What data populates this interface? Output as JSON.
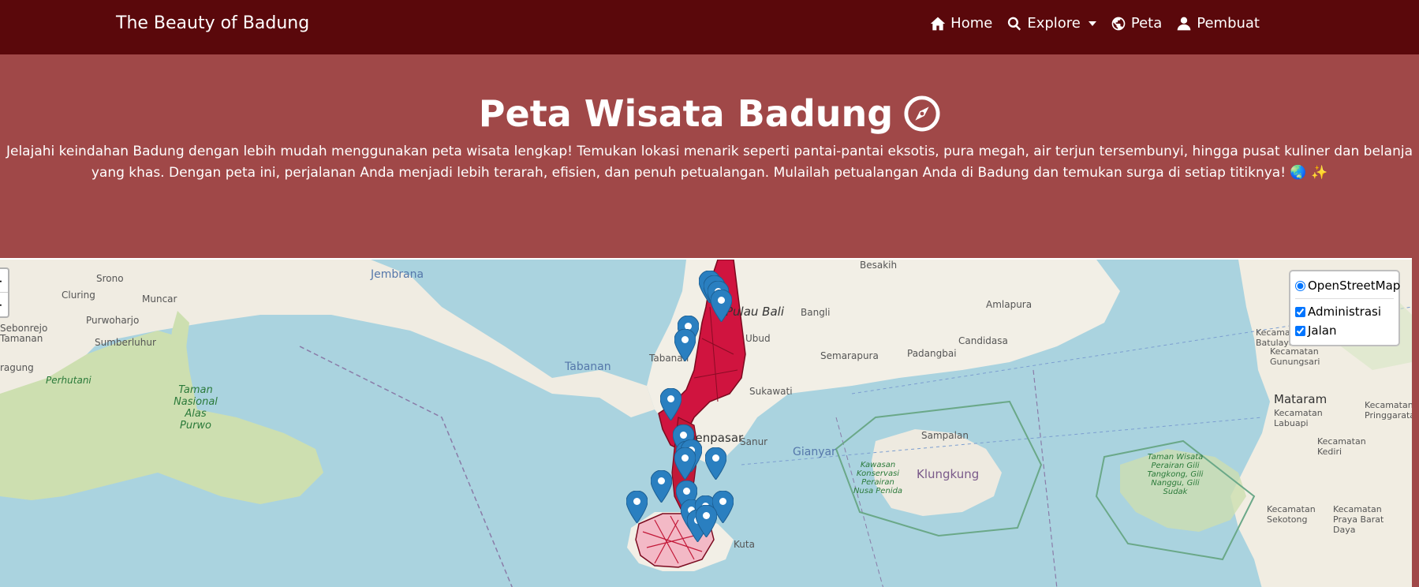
{
  "navbar": {
    "brand": "The Beauty of Badung",
    "items": [
      {
        "label": "Home",
        "icon": "home-icon"
      },
      {
        "label": "Explore",
        "icon": "search-icon"
      },
      {
        "label": "Peta",
        "icon": "globe-icon"
      },
      {
        "label": "Pembuat",
        "icon": "user-icon"
      }
    ]
  },
  "hero": {
    "title": "Peta Wisata Badung",
    "description": "Jelajahi keindahan Badung dengan lebih mudah menggunakan peta wisata lengkap! Temukan lokasi menarik seperti pantai-pantai eksotis, pura megah, air terjun tersembunyi, hingga pusat kuliner dan belanja yang khas. Dengan peta ini, perjalanan Anda menjadi lebih terarah, efisien, dan penuh petualangan. Mulailah petualangan Anda di Badung dan temukan surga di setiap titiknya! 🌏 ✨"
  },
  "map": {
    "zoom_in": "+",
    "zoom_out": "−",
    "base_layer": "OpenStreetMap",
    "overlays": [
      {
        "label": "Administrasi",
        "checked": true
      },
      {
        "label": "Jalan",
        "checked": true
      }
    ],
    "labels": {
      "jembrana": "Jembrana",
      "srono": "Srono",
      "cluring": "Cluring",
      "muncar": "Muncar",
      "purwoharjo": "Purwoharjo",
      "sebonrejo": "Sebonrejo",
      "sumberluhur": "Sumberluhur",
      "tamanan": "Tamanan",
      "ragung": "ragung",
      "perhutani": "Perhutani",
      "taman_nasional": "Taman Nasional Alas Purwo",
      "besakih": "Besakih",
      "pulau_bali": "Pulau Bali",
      "bangli": "Bangli",
      "amlapura": "Amlapura",
      "ubud": "Ubud",
      "tabanan": "Tabanan",
      "tabanan_sea": "Tabanan",
      "candidasa": "Candidasa",
      "semarapura": "Semarapura",
      "padangbai": "Padangbai",
      "sukawati": "Sukawati",
      "denpasar": "Denpasar",
      "sanur": "Sanur",
      "gianyar": "Gianyar",
      "sampalan": "Sampalan",
      "klungkung": "Klungkung",
      "kawasan": "Kawasan Konservasi Perairan Nusa Penida",
      "taman_wisata": "Taman Wisata Perairan Gili Tangkong, Gili Nanggu, Gili Sudak",
      "kec_batulayar": "Kecamatan Batulayar",
      "kec_gunungsari": "Kecamatan Gunungsari",
      "mataram": "Mataram",
      "kec_labuapi": "Kecamatan Labuapi",
      "kec_pringgarata": "Kecamatan Pringgarata",
      "kec_kediri": "Kecamatan Kediri",
      "kec_sekotong": "Kecamatan Sekotong",
      "kec_praya": "Kecamatan Praya Barat Daya",
      "kuta": "Kuta"
    }
  }
}
